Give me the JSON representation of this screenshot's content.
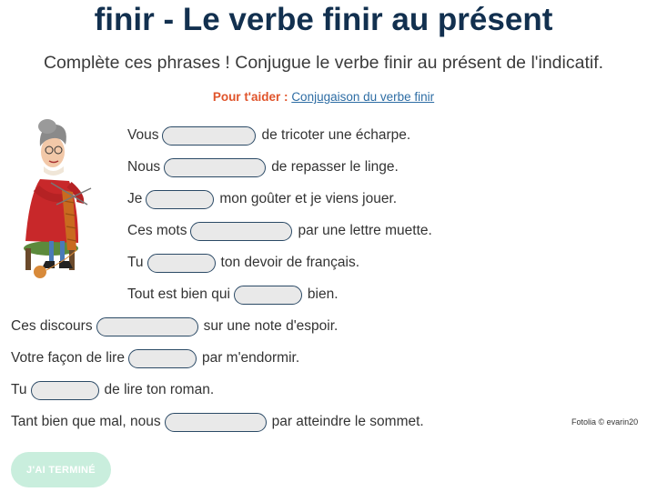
{
  "title": "finir - Le verbe finir au présent",
  "subtitle": "Complète ces phrases ! Conjugue le verbe finir au présent de l'indicatif.",
  "help": {
    "label": "Pour t'aider :",
    "link": "Conjugaison du verbe finir"
  },
  "sentences": [
    {
      "before": "Vous",
      "after": "de tricoter une écharpe.",
      "value": ""
    },
    {
      "before": "Nous",
      "after": "de repasser le linge.",
      "value": ""
    },
    {
      "before": "Je",
      "after": "mon goûter et je viens jouer.",
      "value": ""
    },
    {
      "before": "Ces mots",
      "after": "par une lettre muette.",
      "value": ""
    },
    {
      "before": "Tu",
      "after": "ton devoir de français.",
      "value": ""
    },
    {
      "before": "Tout est bien qui",
      "after": "bien.",
      "value": ""
    },
    {
      "before": "Ces discours",
      "after": "sur une note d'espoir.",
      "value": ""
    },
    {
      "before": "Votre façon de lire",
      "after": "par m'endormir.",
      "value": ""
    },
    {
      "before": "Tu",
      "after": "de lire ton roman.",
      "value": ""
    },
    {
      "before": "Tant bien que mal, nous",
      "after": "par atteindre le sommet.",
      "value": ""
    }
  ],
  "image_credit": "Fotolia © evarin20",
  "done_button": "J'AI TERMINÉ",
  "colors": {
    "title": "#12304f",
    "help_label": "#e0542b",
    "link": "#2e6da4",
    "input_border": "#2b4a66",
    "input_bg": "#e9e9e9",
    "button_bg": "#c9eedd"
  },
  "illustration": "grandmother-knitting-illustration"
}
